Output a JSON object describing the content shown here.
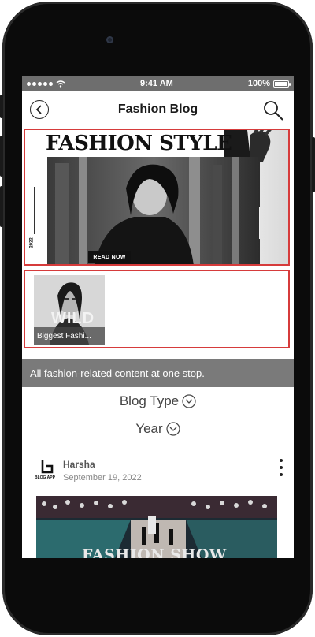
{
  "status_bar": {
    "time": "9:41 AM",
    "battery": "100%"
  },
  "header": {
    "title": "Fashion Blog"
  },
  "hero": {
    "title": "FASHION STYLE",
    "year": "2022",
    "cta": "READ NOW"
  },
  "thumbnails": [
    {
      "overlay_text": "WILD",
      "caption": "Biggest Fashi..."
    }
  ],
  "tagline": "All fashion-related content at one stop.",
  "filters": [
    {
      "label": "Blog Type"
    },
    {
      "label": "Year"
    }
  ],
  "post": {
    "author": "Harsha",
    "date": "September 19, 2022",
    "logo_text": "BLOG APP",
    "image_text": "FASHION SHOW"
  }
}
